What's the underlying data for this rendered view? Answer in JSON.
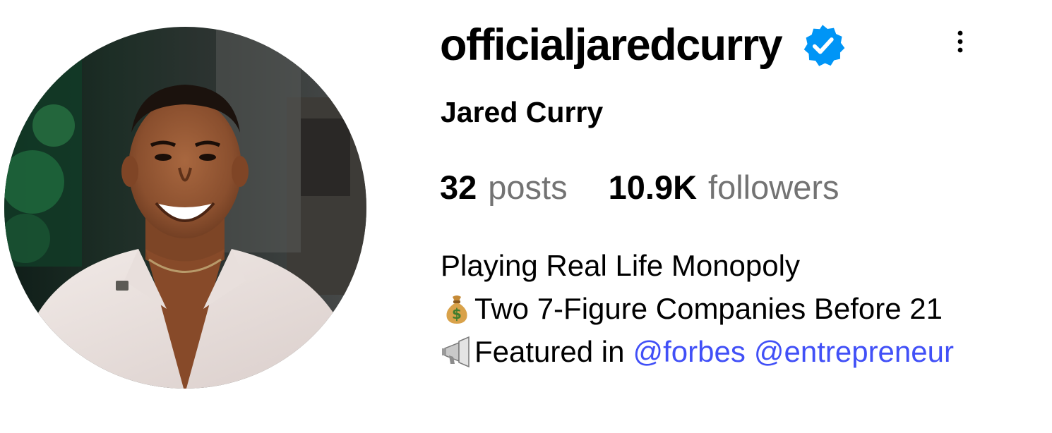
{
  "profile": {
    "username": "officialjaredcurry",
    "verified": true,
    "full_name": "Jared Curry",
    "avatar_alt": "profile photo",
    "stats": [
      {
        "number": "32",
        "label": "posts"
      },
      {
        "number": "10.9K",
        "label": "followers"
      }
    ],
    "bio": {
      "line1": "Playing Real Life Monopoly",
      "line2_emoji": "money-bag-emoji",
      "line2_text": "Two 7-Figure Companies Before 21",
      "line3_emoji": "megaphone-emoji",
      "line3_text": "Featured in",
      "mentions": [
        "@forbes",
        "@entrepreneur"
      ]
    }
  },
  "icons": {
    "verified": "verified-badge-icon",
    "more": "more-options-icon"
  },
  "colors": {
    "verified_blue": "#0095f6",
    "mention_link": "#4150f7",
    "secondary_text": "#737373",
    "primary_text": "#000000"
  }
}
